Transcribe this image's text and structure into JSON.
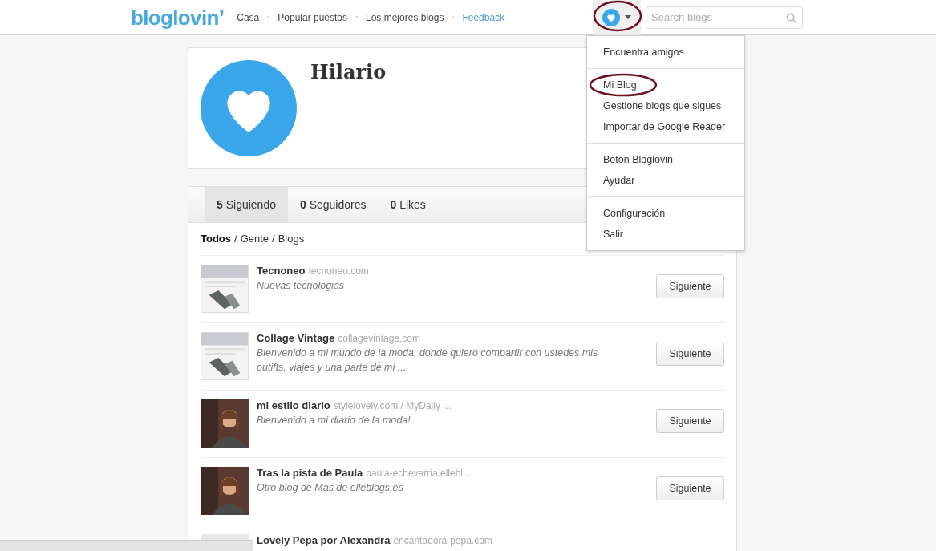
{
  "header": {
    "logo": "bloglovin’",
    "nav": [
      {
        "label": "Casa",
        "kind": "link"
      },
      {
        "label": "Popular puestos",
        "kind": "link"
      },
      {
        "label": "Los mejores blogs",
        "kind": "link"
      },
      {
        "label": "Feedback",
        "kind": "feedback"
      }
    ],
    "menu_button": {
      "circled": true
    },
    "search": {
      "placeholder": "Search blogs"
    }
  },
  "menu": {
    "sections": [
      [
        {
          "label": "Encuentra amigos",
          "circled": false
        }
      ],
      [
        {
          "label": "Mi Blog",
          "circled": true
        },
        {
          "label": "Gestione blogs que sigues",
          "circled": false
        },
        {
          "label": "Importar de Google Reader",
          "circled": false
        }
      ],
      [
        {
          "label": "Botón Bloglovin",
          "circled": false
        },
        {
          "label": "Ayudar",
          "circled": false
        }
      ],
      [
        {
          "label": "Configuración",
          "circled": false
        },
        {
          "label": "Salir",
          "circled": false
        }
      ]
    ]
  },
  "profile": {
    "name": "Hilario"
  },
  "tabs": [
    {
      "count": "5",
      "label": "Siguiendo",
      "selected": true
    },
    {
      "count": "0",
      "label": "Seguidores",
      "selected": false
    },
    {
      "count": "0",
      "label": "Likes",
      "selected": false
    }
  ],
  "filter": {
    "separator": "/",
    "items": [
      {
        "label": "Todos",
        "selected": true
      },
      {
        "label": "Gente",
        "selected": false
      },
      {
        "label": "Blogs",
        "selected": false
      }
    ]
  },
  "blogs": [
    {
      "name": "Tecnoneo",
      "url": "tecnoneo.com",
      "description": "Nuevas tecnologias",
      "button": "Siguiente",
      "kind": "site"
    },
    {
      "name": "Collage Vintage",
      "url": "collagevintage.com",
      "description": "Bienvenido a mi mundo de la moda, donde quiero compartir con ustedes mis outifts, viajes y una parte de mi ...",
      "button": "Siguiente",
      "kind": "site"
    },
    {
      "name": "mi estilo diario",
      "url": "stylelovely.com / MyDaily ...",
      "description": "Bienvenido a mi diario de la moda!",
      "button": "Siguiente",
      "kind": "person"
    },
    {
      "name": "Tras la pista de Paula",
      "url": "paula-echevarria.ellebl ...",
      "description": "Otro blog de Mas de elleblogs.es",
      "button": "Siguiente",
      "kind": "person"
    },
    {
      "name": "Lovely Pepa por Alexandra",
      "url": "encantadora-pepa.com",
      "kind": "hidden"
    }
  ]
}
